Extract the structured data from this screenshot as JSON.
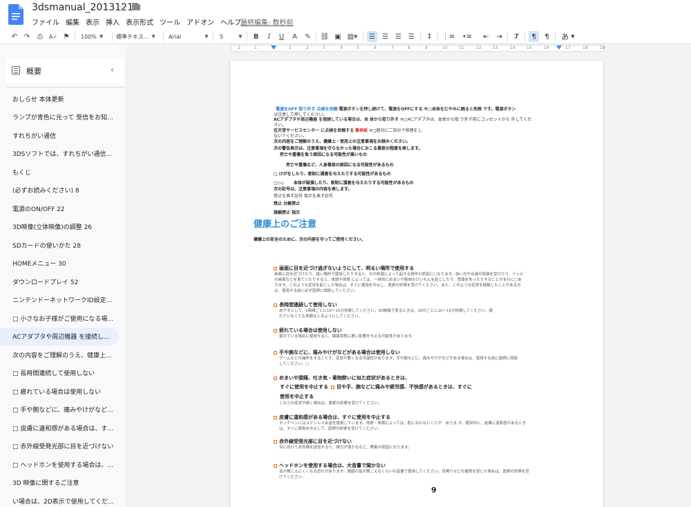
{
  "app": {
    "doc_title": "3dsmanual_20131210",
    "last_edit": "最終編集: 数秒前",
    "menu": [
      "ファイル",
      "編集",
      "表示",
      "挿入",
      "表示形式",
      "ツール",
      "アドオン",
      "ヘルプ"
    ]
  },
  "toolbar": {
    "zoom": "100%",
    "style": "標準テキス...",
    "font": "Arial",
    "size": "5",
    "input_tools": "あ"
  },
  "ruler": {
    "labels": [
      "2",
      "1",
      "1",
      "2",
      "3",
      "4",
      "5",
      "6",
      "7",
      "8",
      "9",
      "10",
      "11",
      "12",
      "13",
      "14",
      "15",
      "16",
      "17",
      "18",
      "19"
    ]
  },
  "sidebar": {
    "title": "概要",
    "items": [
      {
        "label": "おしらせ 本体更新"
      },
      {
        "label": "ランプが青色に光って 受信をお知..."
      },
      {
        "label": "すれちがい通信"
      },
      {
        "label": "3DSソフトでは、すれちがい通信..."
      },
      {
        "label": "もくじ"
      },
      {
        "label": "(必ずお読みください) 8"
      },
      {
        "label": "電源のON/OFF 22"
      },
      {
        "label": "3D映像(立体映像)の調整 26"
      },
      {
        "label": "SDカードの使いかた 28"
      },
      {
        "label": "HOMEメニュー 30"
      },
      {
        "label": "ダウンロードプレイ 52"
      },
      {
        "label": "ニンテンドーネットワークID設定..."
      },
      {
        "label": "□ 小さなお子様がご使用になる場..."
      },
      {
        "label": "ACアダプタや周辺機器 を接続し..."
      },
      {
        "label": "次の内容をご理解のうえ、健康上..."
      },
      {
        "label": "□ 長時間連続して使用しない"
      },
      {
        "label": "□ 疲れている場合は使用しない"
      },
      {
        "label": "□ 手や腕などに、痛みやけがなど..."
      },
      {
        "label": "□ 皮膚に違和感がある場合は、す..."
      },
      {
        "label": "□ 赤外線受発光部に目を近づけない"
      },
      {
        "label": "□ ヘッドホンを使用する場合は、..."
      },
      {
        "label": "3D 映像に関するご注意"
      },
      {
        "label": "い場合は、2D表示で使用してくだ..."
      }
    ]
  },
  "page": {
    "intro": {
      "line1_blue": "電源をOFF  取り外す  点検を依頼",
      "line1_rest": "電源ボタンを押し続けて、電源をOFFにする ※□本体をむやみに触ると危険 です。電源ボタン",
      "line2": "は注意して押してください。",
      "line3_bold": "ACアダプタや周辺機器 を接続している場合は、本 体から取り外す",
      "line3_rest": "※□ACアダプタは、本体から取 り外す前にコンセントから 外してくだ",
      "line4": "さい。",
      "line5_bold": "任天堂サービスセンター に点検を依頼する",
      "line5_red": "裏表紙",
      "line5_rest": "※□絶対にご自分で修理をし",
      "line6": "ないでください。",
      "line7": "次の内容をご理解のうえ、健康上・使用上の注意事項をお読みください。",
      "line8": "次の警告表示は、注意事項を守らなかった場合におこる事故の程度を表します。",
      "line9": "死亡や重傷を負う原因になる可能性が高いもの",
      "line10": "死亡や重傷など、人身事故の原因になる可能性があるもの",
      "line11": "けがをしたり、家財に損害を与えたりする可能性があるもの",
      "line12": "本体が破損したり、家財に損害を与えたりする可能性があるもの",
      "line13": "次の記号は、注意事項の内容を表します。",
      "line14": "禁止を表す記号 指示を表す記号",
      "line15": "禁止  分解禁止",
      "line16": "接触禁止  指示"
    },
    "heading": "健康上のご注意",
    "subheading": "健康上の安全のために、次の内容を守ってご使用ください。",
    "sections": [
      {
        "title": "画面に目を近づけ過ぎないようにして、明るい場所で使用する",
        "body": [
          "画面に目を近づけたり、暗い場所で使用したりすると、光の刺激によって起きる発作の原因に□なります。強い光や点滅の刺激を受けたり、テレビ",
          "の画面などを見ていたりすると、体調や体質 によっては、一時的にめまいや筋肉のけいれんを起こしたり、意識を失ったりすることがまれに□あ",
          "ります。このような症状を起こした場合は、すぐに使用を中止し、医師の診察を受けてください。また、このような症状を経験したことがある方",
          "は、使用する前に必ず医師に相談してください。"
        ]
      },
      {
        "title": "長時間連続して使用しない",
        "body": [
          "めやすとして、1時間ごとに10～15分休憩してください。3D映像で見るときは、30分ごとに10～15分休憩してください。疲",
          "れていなくても休憩はとるようにしてください。"
        ]
      },
      {
        "title": "疲れている場合は使用しない",
        "body": [
          "疲れている場合に使用すると、健康状態に悪い影響を与える可能性があります。"
        ]
      },
      {
        "title": "手や腕などに、痛みやけがなどがある場合は使用しない",
        "body": [
          "ゲームなどの操作をすることで、症状が悪くなる可能性があります。手や腕などに、痛みやけがなどがある場合は、使用する前に医師に相談",
          "してください。□"
        ]
      },
      {
        "title": "めまいや頭痛、吐き気・乗物酔いに似た症状があるときは、",
        "line2": "すぐに使用を中止する",
        "line2b": "目や手、腕などに痛みや疲労感、不快感があるときは、すぐに",
        "line3": "使用を中止する",
        "body": [
          "これらの症状が続く場合は、医師の診察を受けてください。"
        ]
      },
      {
        "title": "皮膚に違和感がある場合は、すぐに使用を中止する",
        "body": [
          "タッチペンにはステンレス合金を使用しています。体質・体調によっては、肌に合わないことが　ありま す。使用中に、皮膚に違和感があるとき",
          "は、すぐに使用を中止して、医師の診察を受けてください。"
        ]
      },
      {
        "title": "赤外線受発光部に目を近づけない",
        "body": [
          "目に向けて赤外線を送信すると、視力が落ちるなど、障害の原因になります。"
        ]
      },
      {
        "title": "ヘッドホンを使用する場合は、大音量で聞かない",
        "body": [
          "耳が聞こえにくくなる恐れがあります。周囲の音が聞こえるくらいの音量で使用してください。耳鳴りなどの異常を感じた場合は、医師の診察を受",
          "けてください。"
        ]
      }
    ],
    "page_number": "9"
  }
}
